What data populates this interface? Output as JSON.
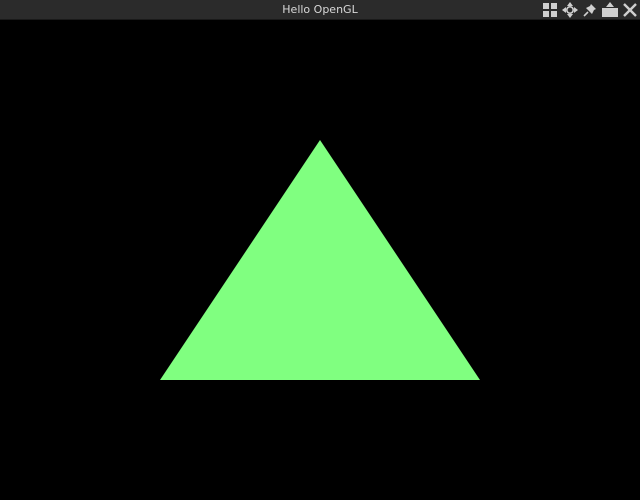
{
  "window": {
    "title": "Hello OpenGL"
  },
  "titlebar_controls": [
    {
      "name": "tile-layout-icon"
    },
    {
      "name": "move-icon"
    },
    {
      "name": "pin-icon"
    },
    {
      "name": "minimize-icon"
    },
    {
      "name": "close-icon"
    }
  ],
  "scene": {
    "background_color": "#000000",
    "triangle_color": "#80ff80"
  }
}
